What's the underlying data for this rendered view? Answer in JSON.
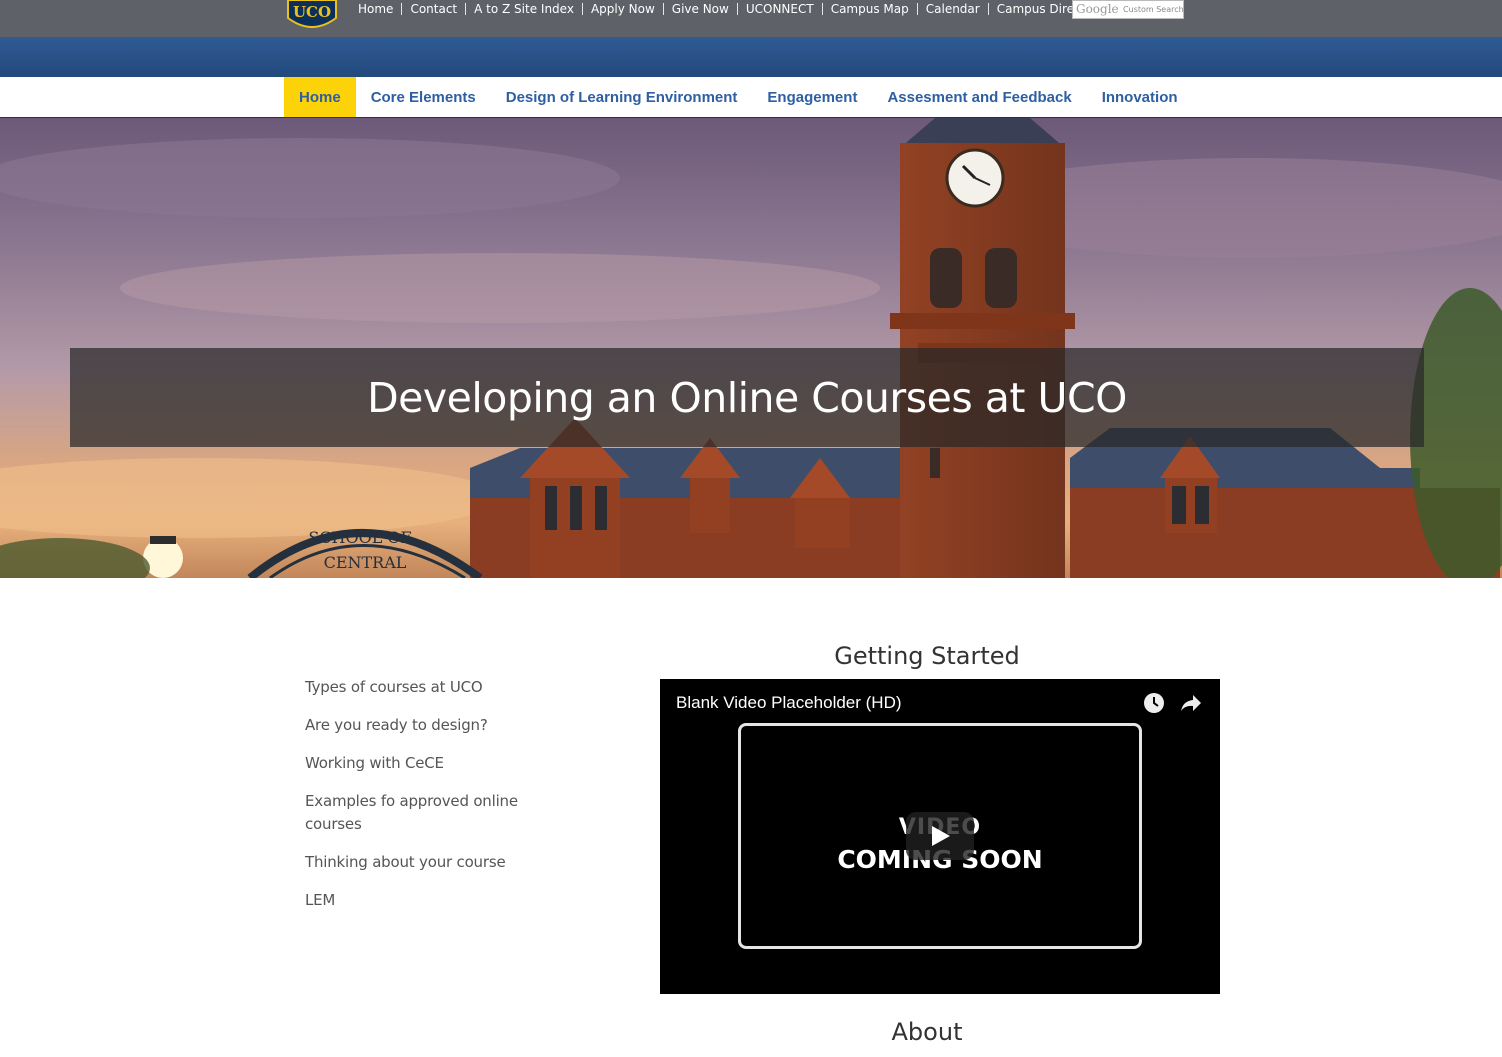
{
  "utility_nav": {
    "logo_text": "UCO",
    "links": [
      "Home",
      "Contact",
      "A to Z Site Index",
      "Apply Now",
      "Give Now",
      "UCONNECT",
      "Campus Map",
      "Calendar",
      "Campus Directory"
    ],
    "search": {
      "brand": "Google",
      "placeholder": "Custom Search"
    }
  },
  "main_nav": {
    "items": [
      "Home",
      "Core Elements",
      "Design of Learning Environment",
      "Engagement",
      "Assesment and Feedback",
      "Innovation"
    ],
    "active": "Home"
  },
  "hero": {
    "title": "Developing an Online Courses at UCO",
    "arch_text_top": "SCHOOL OF",
    "arch_text_bottom": "CENTRAL"
  },
  "sidebar": {
    "links": [
      "Types of courses at UCO",
      "Are you ready to design?",
      "Working with CeCE",
      "Examples fo approved online courses",
      "Thinking about your course",
      "LEM"
    ]
  },
  "content": {
    "getting_started_title": "Getting Started",
    "video": {
      "title": "Blank Video Placeholder (HD)",
      "line1": "VIDEO",
      "line2": "COMING SOON"
    },
    "about_title": "About"
  },
  "colors": {
    "utility_bar": "#5e6168",
    "band": "#2f5a93",
    "nav_text": "#2e5fa3",
    "nav_active": "#fcd209"
  }
}
